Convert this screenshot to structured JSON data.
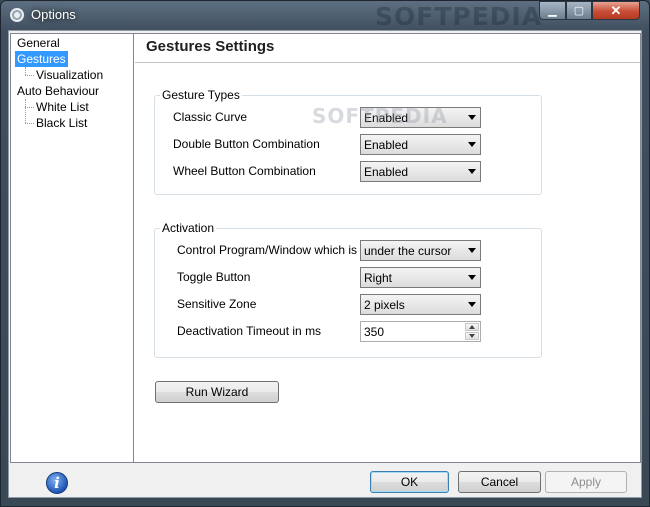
{
  "window": {
    "title": "Options",
    "watermark": "SOFTPEDIA"
  },
  "tree": {
    "items": [
      {
        "label": "General"
      },
      {
        "label": "Gestures"
      },
      {
        "label": "Visualization"
      },
      {
        "label": "Auto Behaviour"
      },
      {
        "label": "White List"
      },
      {
        "label": "Black List"
      }
    ],
    "selected": "Gestures"
  },
  "panel": {
    "title": "Gestures Settings",
    "watermark": "SOFTPEDIA",
    "gesture_types": {
      "caption": "Gesture Types",
      "rows": [
        {
          "label": "Classic Curve",
          "value": "Enabled"
        },
        {
          "label": "Double Button Combination",
          "value": "Enabled"
        },
        {
          "label": "Wheel Button Combination",
          "value": "Enabled"
        }
      ]
    },
    "activation": {
      "caption": "Activation",
      "rows": [
        {
          "label": "Control Program/Window which is",
          "value": "under the cursor"
        },
        {
          "label": "Toggle Button",
          "value": "Right"
        },
        {
          "label": "Sensitive Zone",
          "value": "2 pixels"
        },
        {
          "label": "Deactivation Timeout in ms",
          "value": "350"
        }
      ]
    },
    "run_wizard_label": "Run Wizard"
  },
  "footer": {
    "ok_label": "OK",
    "cancel_label": "Cancel",
    "apply_label": "Apply",
    "info_glyph": "i"
  },
  "icons": {
    "title": "gear-icon",
    "info": "info-icon",
    "close": "close-icon"
  },
  "colors": {
    "selection": "#3399ff",
    "close_button": "#c74d36"
  }
}
